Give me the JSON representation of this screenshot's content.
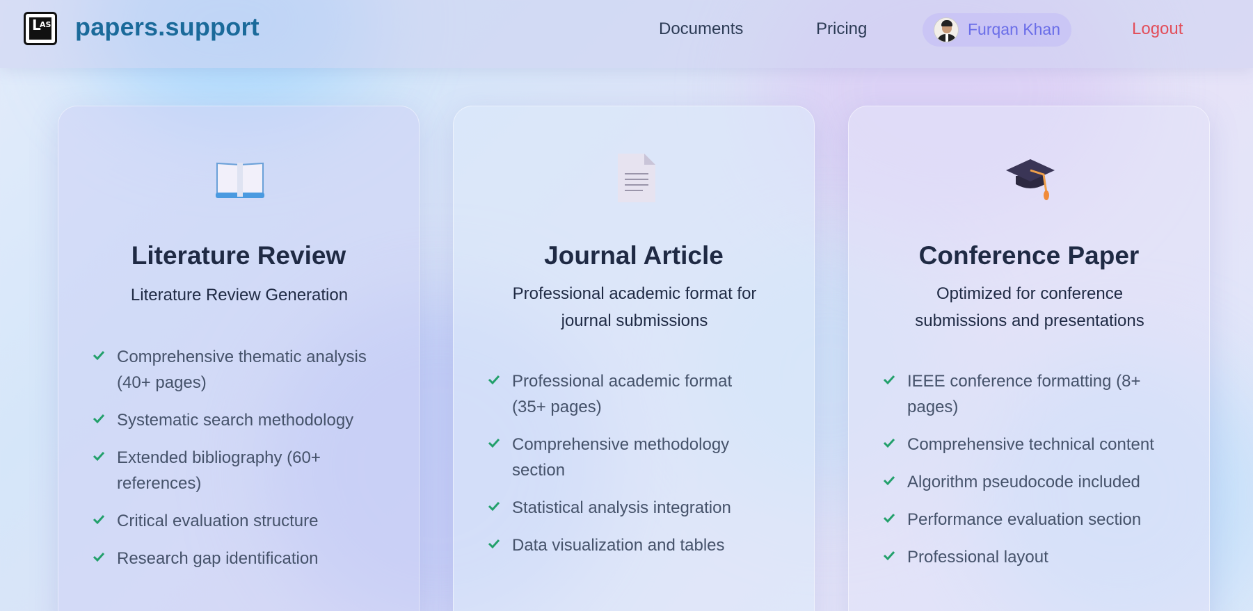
{
  "header": {
    "brand": "papers.support",
    "nav": {
      "documents": "Documents",
      "pricing": "Pricing"
    },
    "user_name": "Furqan Khan",
    "logout": "Logout"
  },
  "cards": [
    {
      "icon": "open-book-icon",
      "title": "Literature Review",
      "subtitle": "Literature Review Generation",
      "features": [
        "Comprehensive thematic analysis (40+ pages)",
        "Systematic search methodology",
        "Extended bibliography (60+ references)",
        "Critical evaluation structure",
        "Research gap identification"
      ]
    },
    {
      "icon": "document-icon",
      "title": "Journal Article",
      "subtitle": "Professional academic format for journal submissions",
      "features": [
        "Professional academic format (35+ pages)",
        "Comprehensive methodology section",
        "Statistical analysis integration",
        "Data visualization and tables"
      ]
    },
    {
      "icon": "graduation-cap-icon",
      "title": "Conference Paper",
      "subtitle": "Optimized for conference submissions and presentations",
      "features": [
        "IEEE conference formatting (8+ pages)",
        "Comprehensive technical content",
        "Algorithm pseudocode included",
        "Performance evaluation section",
        "Professional layout"
      ]
    }
  ],
  "colors": {
    "brand": "#1a6a9a",
    "logout": "#e24d59",
    "user": "#6a6de8",
    "check": "#22a06b"
  }
}
